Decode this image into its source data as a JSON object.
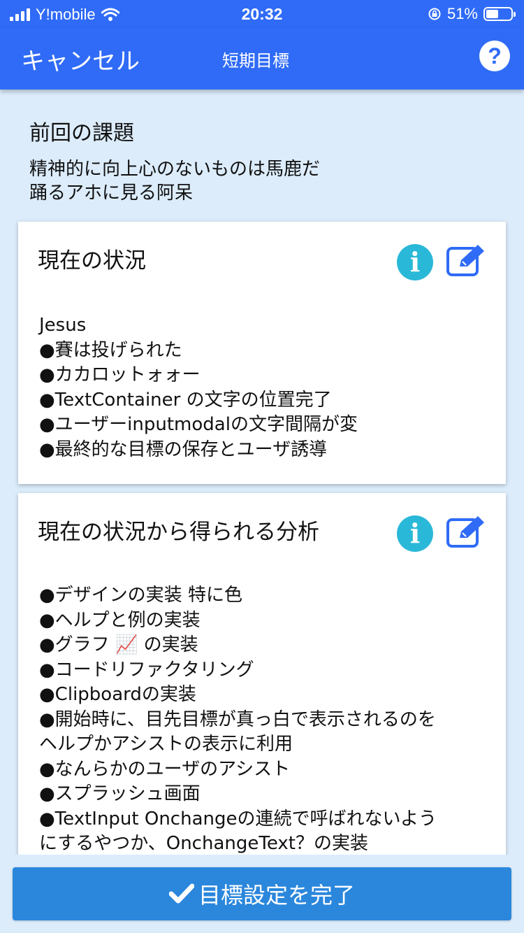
{
  "status_bar": {
    "carrier": "Y!mobile",
    "time": "20:32",
    "battery_percent": "51%",
    "battery_level": 0.51
  },
  "nav": {
    "cancel_label": "キャンセル",
    "title": "短期目標",
    "help_label": "?"
  },
  "previous": {
    "title": "前回の課題",
    "body": " 精神的に向上心のないものは馬鹿だ\n踊るアホに見る阿呆"
  },
  "card1": {
    "title": "現在の状況",
    "info_glyph": "i",
    "body": "Jesus\n●賽は投げられた\n●カカロットォォー\n●TextContainer の文字の位置完了\n●ユーザーinputmodalの文字間隔が変\n●最終的な目標の保存とユーザ誘導"
  },
  "card2": {
    "title": "現在の状況から得られる分析",
    "info_glyph": "i",
    "body": "●デザインの実装 特に色\n●ヘルプと例の実装\n●グラフ 📈 の実装\n●コードリファクタリング\n●Clipboardの実装\n●開始時に、目先目標が真っ白で表示されるのを\nヘルプかアシストの表示に利用\n●なんらかのユーザのアシスト\n●スプラッシュ画面\n●TextInput Onchangeの連続で呼ばれないよう\nにするやつか、OnchangeText？の実装"
  },
  "footer": {
    "complete_label": "目標設定を完了"
  },
  "colors": {
    "header": "#2f6bf6",
    "background": "#dcecfb",
    "info_icon": "#2ab8d8",
    "edit_icon": "#2f6bf6",
    "button": "#2b87dc"
  },
  "icons": [
    "signal-icon",
    "wifi-icon",
    "lock-rotation-icon",
    "battery-icon",
    "help-icon",
    "info-icon",
    "edit-icon",
    "check-icon"
  ]
}
